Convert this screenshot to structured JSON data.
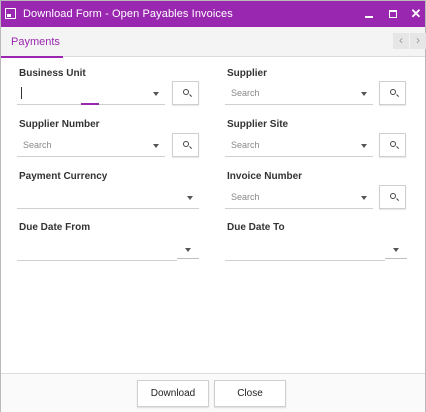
{
  "window": {
    "title": "Download Form - Open Payables Invoices",
    "accent": "#9a27b0"
  },
  "titlebar": {
    "minimize": "minimize",
    "maximize": "maximize",
    "close_glyph": "✕"
  },
  "tabs": [
    {
      "label": "Payments",
      "active": true
    }
  ],
  "tabnav": {
    "prev": "‹",
    "next": "›"
  },
  "form": {
    "business_unit": {
      "label": "Business Unit",
      "value": ""
    },
    "supplier": {
      "label": "Supplier",
      "placeholder": "Search"
    },
    "supplier_number": {
      "label": "Supplier Number",
      "placeholder": "Search"
    },
    "supplier_site": {
      "label": "Supplier Site",
      "placeholder": "Search"
    },
    "payment_currency": {
      "label": "Payment Currency",
      "value": ""
    },
    "invoice_number": {
      "label": "Invoice Number",
      "placeholder": "Search"
    },
    "due_date_from": {
      "label": "Due Date From",
      "value": ""
    },
    "due_date_to": {
      "label": "Due Date To",
      "value": ""
    }
  },
  "footer": {
    "download_label": "Download",
    "close_label": "Close"
  },
  "icons": {
    "search": "search-icon",
    "dropdown": "chevron-down-icon",
    "app": "form-window-icon"
  }
}
